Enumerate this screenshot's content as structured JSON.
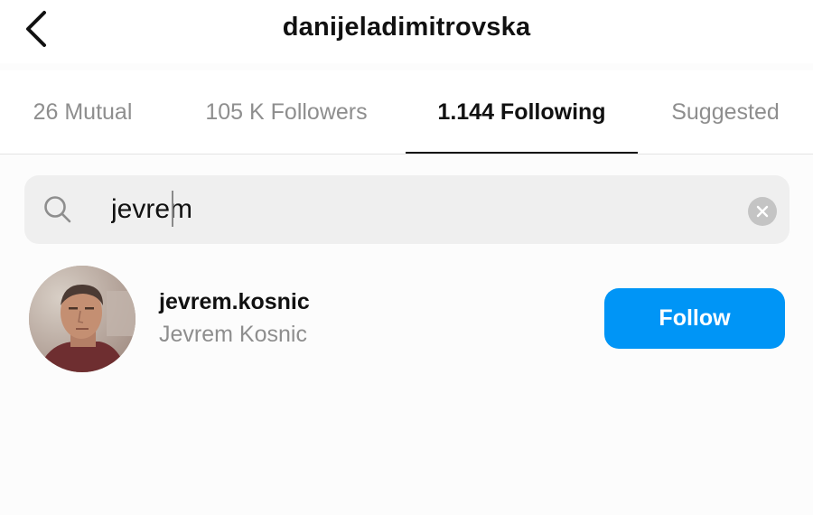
{
  "header": {
    "title": "danijeladimitrovska",
    "back_icon": "chevron-left-icon"
  },
  "tabs": [
    {
      "label": "26 Mutual",
      "active": false
    },
    {
      "label": "105 K Followers",
      "active": false
    },
    {
      "label": "1.144 Following",
      "active": true
    },
    {
      "label": "Suggested",
      "active": false
    }
  ],
  "search": {
    "value": "jevrem",
    "search_icon": "search-icon",
    "clear_icon": "clear-icon"
  },
  "results": [
    {
      "username": "jevrem.kosnic",
      "full_name": "Jevrem Kosnic",
      "button_label": "Follow",
      "avatar_icon": "avatar"
    }
  ],
  "colors": {
    "accent": "#0095f6",
    "muted_text": "#8e8e8e",
    "search_bg": "#efefef"
  }
}
